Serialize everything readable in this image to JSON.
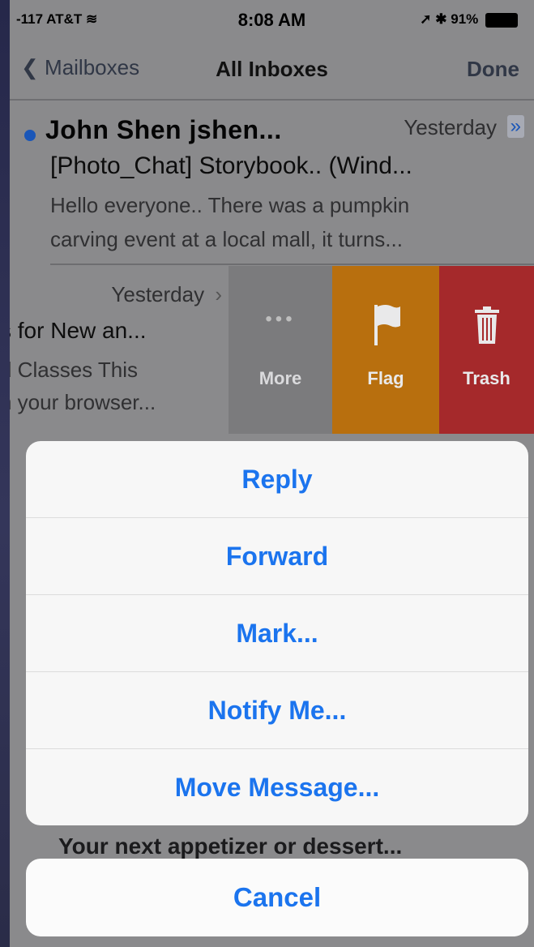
{
  "status_bar": {
    "carrier": "-117 AT&T",
    "time": "8:08 AM",
    "battery": "91%"
  },
  "nav": {
    "back_label": "Mailboxes",
    "title": "All Inboxes",
    "done_label": "Done"
  },
  "messages": [
    {
      "sender": "John Shen jshen...",
      "date": "Yesterday",
      "subject": "[Photo_Chat] Storybook.. (Wind...",
      "preview_line1": "Hello everyone.. There was a pumpkin",
      "preview_line2": "carving event at a local mall, it turns..."
    },
    {
      "date": "Yesterday",
      "subject": "s for New an...",
      "preview_line1": "d Classes This",
      "preview_line2": "n your browser..."
    }
  ],
  "swipe_actions": [
    {
      "label": "More",
      "icon": "more-dots-icon"
    },
    {
      "label": "Flag",
      "icon": "flag-icon"
    },
    {
      "label": "Trash",
      "icon": "trash-icon"
    }
  ],
  "background_row_text": "Your next appetizer or dessert...",
  "action_sheet": {
    "items": [
      "Reply",
      "Forward",
      "Mark...",
      "Notify Me...",
      "Move Message..."
    ],
    "cancel": "Cancel"
  },
  "colors": {
    "accent": "#1b74ee",
    "flag": "#b86f0e",
    "trash": "#a5292b",
    "more": "#7b7b7d"
  }
}
